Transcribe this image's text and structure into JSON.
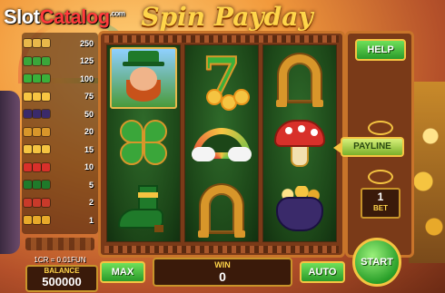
{
  "logo": {
    "slot": "Slot",
    "catalog": "Catalog",
    "com": ".com"
  },
  "title": "Spin Payday",
  "paytable": [
    {
      "symbol": "leprechaun",
      "color": "#e8b84a",
      "value": "250"
    },
    {
      "symbol": "clover",
      "color": "#3aa63a",
      "value": "125"
    },
    {
      "symbol": "seven",
      "color": "#3ab03a",
      "value": "100"
    },
    {
      "symbol": "rainbow",
      "color": "#f7c542",
      "value": "75"
    },
    {
      "symbol": "pot",
      "color": "#3a2a6a",
      "value": "50"
    },
    {
      "symbol": "horseshoe",
      "color": "#d8962a",
      "value": "20"
    },
    {
      "symbol": "seven-small",
      "color": "#f5c441",
      "value": "15"
    },
    {
      "symbol": "mushroom",
      "color": "#d8302a",
      "value": "10"
    },
    {
      "symbol": "boot",
      "color": "#1f7a2a",
      "value": "5"
    },
    {
      "symbol": "gem",
      "color": "#c83a2a",
      "value": "2"
    },
    {
      "symbol": "coin",
      "color": "#e8a92a",
      "value": "1"
    }
  ],
  "credit_info": "1CR = 0.01FUN",
  "balance": {
    "label": "BALANCE",
    "value": "500000"
  },
  "reels": [
    [
      "leprechaun",
      "clover",
      "boot"
    ],
    [
      "seven",
      "rainbow",
      "horseshoe"
    ],
    [
      "horseshoe",
      "mushroom",
      "pot"
    ]
  ],
  "seven_label": "7",
  "buttons": {
    "help": "HELP",
    "payline": "PAYLINE",
    "max": "MAX",
    "auto": "AUTO",
    "start": "START"
  },
  "bet": {
    "value": "1",
    "label": "BET"
  },
  "win": {
    "label": "WIN",
    "value": "0"
  }
}
